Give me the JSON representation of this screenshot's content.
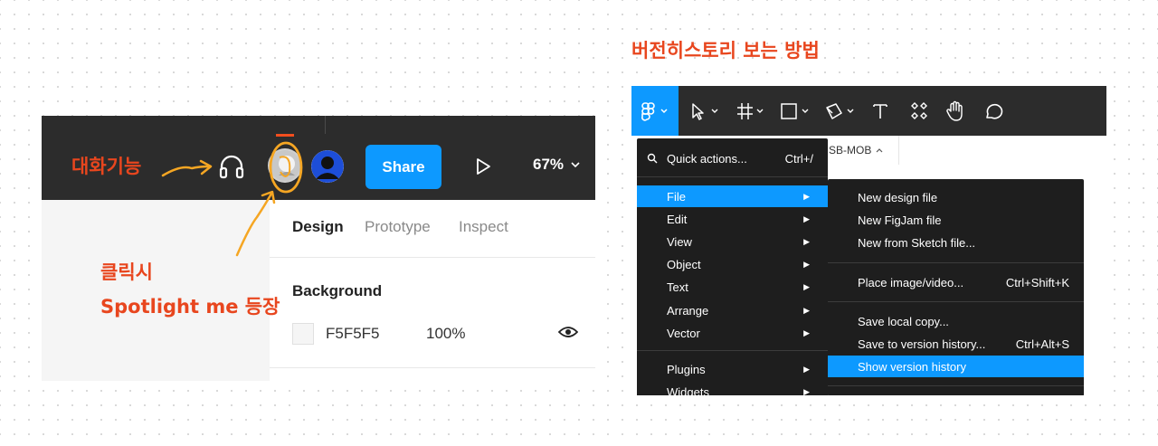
{
  "annotations": {
    "talk_feature": "대화기능",
    "click_line1": "클릭시",
    "click_line2": "Spotlight me 등장",
    "right_title": "버전히스토리 보는 방법"
  },
  "left_ui": {
    "share_label": "Share",
    "zoom_label": "67%",
    "tabs": [
      "Design",
      "Prototype",
      "Inspect"
    ],
    "background_label": "Background",
    "background_hex": "F5F5F5",
    "background_opacity": "100%",
    "icons": [
      "headphones-icon",
      "spotlight-avatar",
      "user-avatar-icon",
      "present-icon",
      "chevron-down-icon",
      "eye-icon"
    ]
  },
  "right_ui": {
    "file_tab_label": "SB-MOB",
    "tools": [
      "main-menu-icon",
      "move-tool-icon",
      "frame-tool-icon",
      "shape-tool-icon",
      "pen-tool-icon",
      "text-tool-icon",
      "components-icon",
      "hand-tool-icon",
      "comment-icon"
    ],
    "main_menu": {
      "quick_actions": {
        "label": "Quick actions...",
        "shortcut": "Ctrl+/"
      },
      "items": [
        "File",
        "Edit",
        "View",
        "Object",
        "Text",
        "Arrange",
        "Vector"
      ],
      "plugins": "Plugins",
      "widgets": "Widgets",
      "highlighted": "File"
    },
    "file_submenu": {
      "group1": [
        "New design file",
        "New FigJam file",
        "New from Sketch file..."
      ],
      "place_image": {
        "label": "Place image/video...",
        "shortcut": "Ctrl+Shift+K"
      },
      "save_local": "Save local copy...",
      "save_version": {
        "label": "Save to version history...",
        "shortcut": "Ctrl+Alt+S"
      },
      "show_version_history": "Show version history"
    }
  },
  "colors": {
    "accent": "#0d99ff",
    "annotation": "#e8461e",
    "toolbar_bg": "#2c2c2c",
    "menu_bg": "#1e1e1e",
    "highlight_circle": "#f5a623"
  }
}
